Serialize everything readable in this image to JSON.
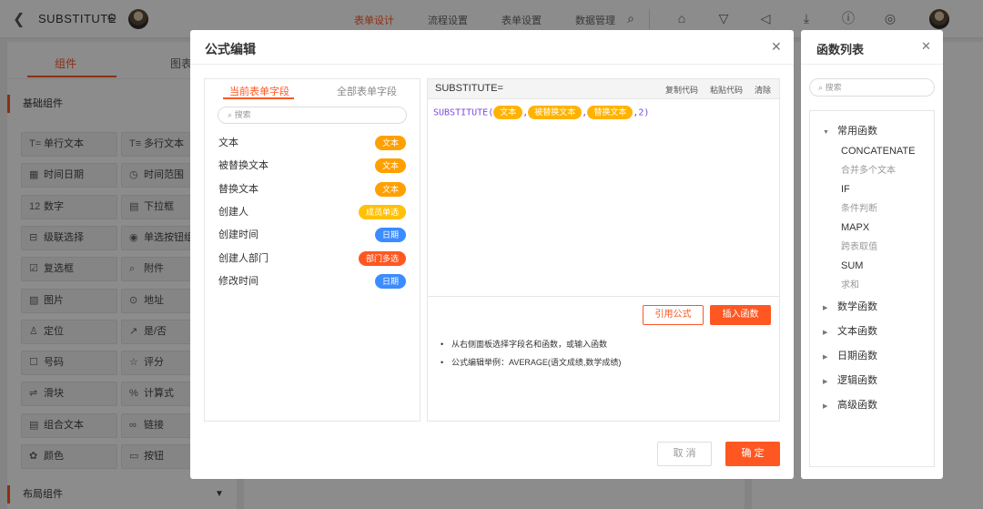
{
  "topbar": {
    "title": "SUBSTITUTE",
    "nav": [
      "表单设计",
      "流程设置",
      "表单设置",
      "数据管理"
    ]
  },
  "leftpanel": {
    "tabs": [
      "组件",
      "图表"
    ],
    "section": "基础组件",
    "items": [
      {
        "icon": "T=",
        "label": "单行文本"
      },
      {
        "icon": "T≡",
        "label": "多行文本"
      },
      {
        "icon": "▦",
        "label": "时间日期"
      },
      {
        "icon": "◷",
        "label": "时间范围"
      },
      {
        "icon": "12",
        "label": "数字"
      },
      {
        "icon": "▤",
        "label": "下拉框"
      },
      {
        "icon": "⊟",
        "label": "级联选择"
      },
      {
        "icon": "◉",
        "label": "单选按钮组"
      },
      {
        "icon": "☑",
        "label": "复选框"
      },
      {
        "icon": "⌕",
        "label": "附件"
      },
      {
        "icon": "▨",
        "label": "图片"
      },
      {
        "icon": "⊙",
        "label": "地址"
      },
      {
        "icon": "♙",
        "label": "定位"
      },
      {
        "icon": "↗",
        "label": "是/否"
      },
      {
        "icon": "☐",
        "label": "号码"
      },
      {
        "icon": "☆",
        "label": "评分"
      },
      {
        "icon": "⇌",
        "label": "滑块"
      },
      {
        "icon": "%",
        "label": "计算式"
      },
      {
        "icon": "▤",
        "label": "组合文本"
      },
      {
        "icon": "∞",
        "label": "链接"
      },
      {
        "icon": "✿",
        "label": "颜色"
      },
      {
        "icon": "▭",
        "label": "按钮"
      }
    ],
    "bottom_section": "布局组件"
  },
  "modal": {
    "title": "公式编辑",
    "field_tabs": [
      "当前表单字段",
      "全部表单字段"
    ],
    "search_placeholder": "搜索",
    "fields": [
      {
        "label": "文本",
        "tag": "文本",
        "tag_color": "#ffa000"
      },
      {
        "label": "被替换文本",
        "tag": "文本",
        "tag_color": "#ffa000"
      },
      {
        "label": "替换文本",
        "tag": "文本",
        "tag_color": "#ffa000"
      },
      {
        "label": "创建人",
        "tag": "成员单选",
        "tag_color": "#ffc107"
      },
      {
        "label": "创建时间",
        "tag": "日期",
        "tag_color": "#3b8cff"
      },
      {
        "label": "创建人部门",
        "tag": "部门多选",
        "tag_color": "#ff5722"
      },
      {
        "label": "修改时间",
        "tag": "日期",
        "tag_color": "#3b8cff"
      }
    ],
    "editor": {
      "header": "SUBSTITUTE=",
      "actions": [
        "复制代码",
        "粘贴代码",
        "清除"
      ],
      "formula_fn": "SUBSTITUTE(",
      "chips": [
        "文本",
        "被替换文本",
        "替换文本"
      ],
      "separator": ",",
      "formula_end": ",2)",
      "btn_ref": "引用公式",
      "btn_insert": "插入函数",
      "hints": [
        "从右侧面板选择字段名和函数，或输入函数",
        "公式编辑举例：AVERAGE(语文成绩,数学成绩)"
      ]
    },
    "btn_cancel": "取 消",
    "btn_ok": "确 定"
  },
  "fnlist": {
    "title": "函数列表",
    "search_placeholder": "搜索",
    "common_category": "常用函数",
    "common_functions": [
      {
        "name": "CONCATENATE",
        "desc": "合并多个文本"
      },
      {
        "name": "IF",
        "desc": "条件判断"
      },
      {
        "name": "MAPX",
        "desc": "跨表取值"
      },
      {
        "name": "SUM",
        "desc": "求和"
      }
    ],
    "categories": [
      "数学函数",
      "文本函数",
      "日期函数",
      "逻辑函数",
      "高级函数"
    ]
  },
  "colors": {
    "accent": "#ff5722",
    "chip": "#ffb300",
    "formula": "#7a4be0"
  }
}
